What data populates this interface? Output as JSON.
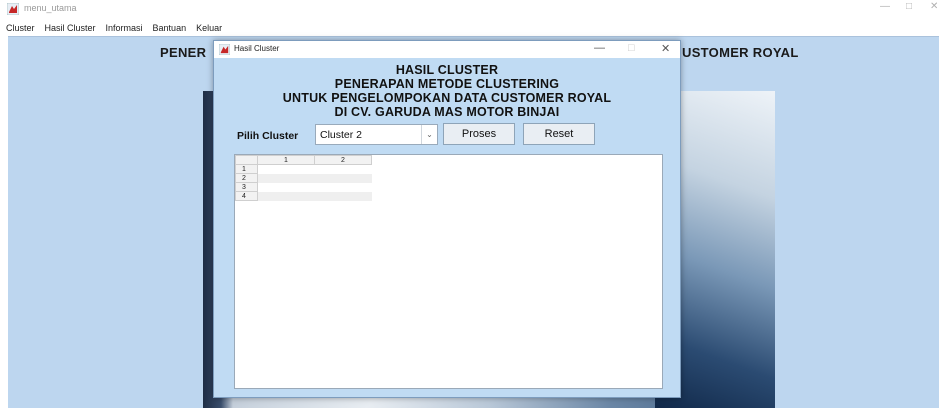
{
  "main_window": {
    "title": "menu_utama",
    "menu": [
      "Cluster",
      "Hasil Cluster",
      "Informasi",
      "Bantuan",
      "Keluar"
    ],
    "heading_left": "PENER",
    "heading_right": "USTOMER ROYAL",
    "controls": {
      "minimize": "—",
      "maximize": "□",
      "close": "✕"
    }
  },
  "dialog": {
    "title": "Hasil Cluster",
    "controls": {
      "minimize": "—",
      "maximize": "□",
      "close": "✕"
    },
    "heading_lines": [
      "HASIL CLUSTER",
      "PENERAPAN METODE CLUSTERING",
      "UNTUK PENGELOMPOKAN DATA CUSTOMER ROYAL",
      "DI CV. GARUDA MAS MOTOR BINJAI"
    ],
    "cluster_label": "Pilih Cluster",
    "cluster_select": {
      "value": "Cluster 2",
      "arrow": "⌄"
    },
    "buttons": {
      "proses": "Proses",
      "reset": "Reset"
    },
    "table": {
      "columns": [
        "1",
        "2"
      ],
      "rows": [
        {
          "label": "1",
          "cells": [
            "",
            ""
          ]
        },
        {
          "label": "2",
          "cells": [
            "",
            ""
          ]
        },
        {
          "label": "3",
          "cells": [
            "",
            ""
          ]
        },
        {
          "label": "4",
          "cells": [
            "",
            ""
          ]
        }
      ]
    }
  },
  "colors": {
    "canvas": "#bdd6ef",
    "dialog_bg": "#c0dbf3",
    "app_icon_red": "#c62828"
  }
}
